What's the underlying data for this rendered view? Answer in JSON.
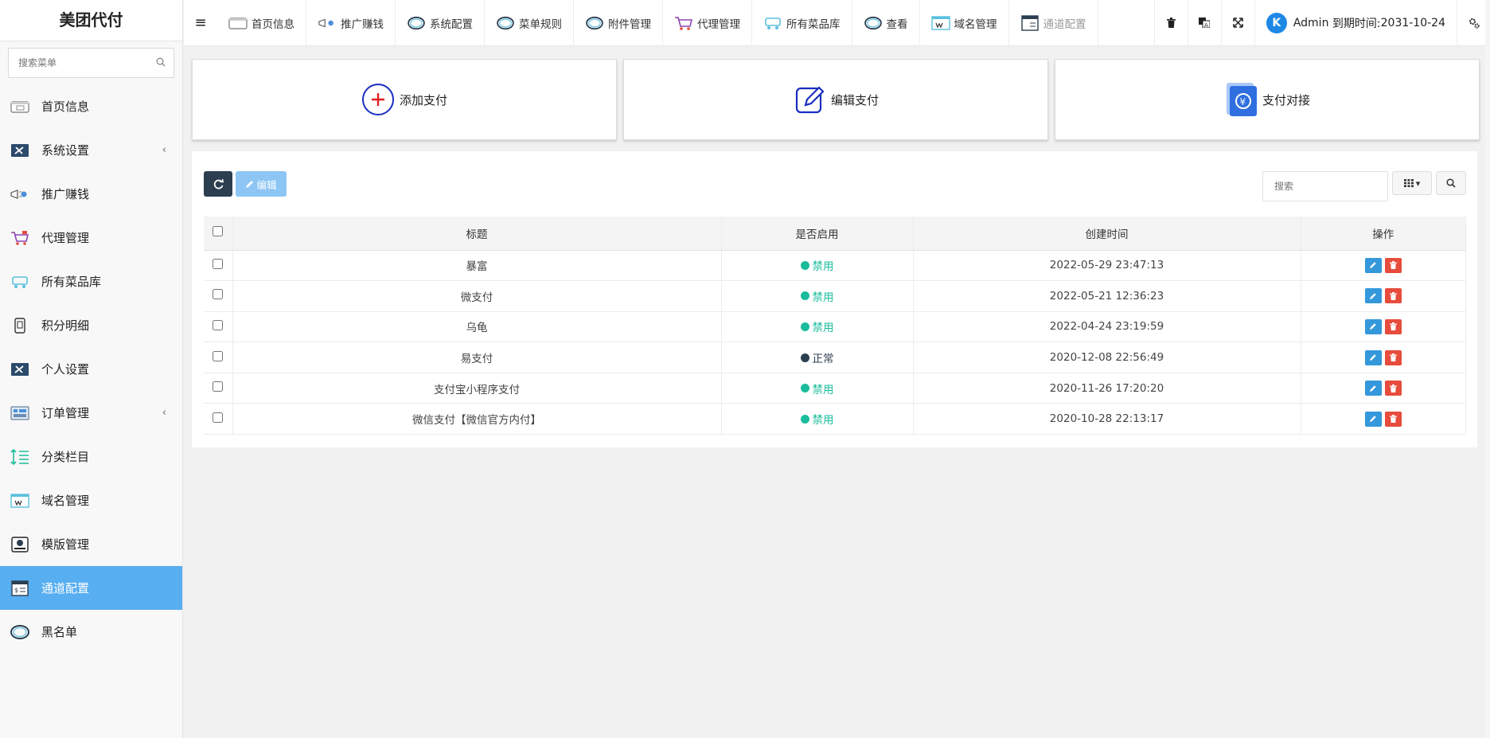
{
  "app": {
    "title": "美团代付"
  },
  "sidebar": {
    "search_placeholder": "搜索菜单",
    "items": [
      {
        "label": "首页信息",
        "icon": "browser-icon",
        "arrow": ""
      },
      {
        "label": "系统设置",
        "icon": "tools-icon",
        "arrow": "‹"
      },
      {
        "label": "推广赚钱",
        "icon": "megaphone-icon",
        "arrow": ""
      },
      {
        "label": "代理管理",
        "icon": "cart-icon",
        "arrow": ""
      },
      {
        "label": "所有菜品库",
        "icon": "trolley-icon",
        "arrow": ""
      },
      {
        "label": "积分明细",
        "icon": "phone-card-icon",
        "arrow": ""
      },
      {
        "label": "个人设置",
        "icon": "tools-icon",
        "arrow": ""
      },
      {
        "label": "订单管理",
        "icon": "orders-icon",
        "arrow": "‹"
      },
      {
        "label": "分类栏目",
        "icon": "sort-list-icon",
        "arrow": ""
      },
      {
        "label": "域名管理",
        "icon": "domain-icon",
        "arrow": ""
      },
      {
        "label": "模版管理",
        "icon": "template-icon",
        "arrow": ""
      },
      {
        "label": "通道配置",
        "icon": "channel-icon",
        "arrow": ""
      },
      {
        "label": "黑名单",
        "icon": "ring-icon",
        "arrow": ""
      }
    ],
    "active_index": 11
  },
  "topnav": {
    "tabs": [
      {
        "label": "首页信息",
        "icon": "browser-icon"
      },
      {
        "label": "推广赚钱",
        "icon": "megaphone-icon"
      },
      {
        "label": "系统配置",
        "icon": "ring-icon"
      },
      {
        "label": "菜单规则",
        "icon": "ring-icon"
      },
      {
        "label": "附件管理",
        "icon": "ring-icon"
      },
      {
        "label": "代理管理",
        "icon": "cart-icon"
      },
      {
        "label": "所有菜品库",
        "icon": "trolley-icon"
      },
      {
        "label": "查看",
        "icon": "ring-icon"
      },
      {
        "label": "域名管理",
        "icon": "domain-icon"
      },
      {
        "label": "通道配置",
        "icon": "channel-icon"
      }
    ],
    "user": {
      "avatar": "K",
      "name": "Admin",
      "expire_label": "到期时间:",
      "expire_date": "2031-10-24"
    }
  },
  "cards": [
    {
      "label": "添加支付",
      "icon": "plus-circle-icon"
    },
    {
      "label": "编辑支付",
      "icon": "edit-square-icon"
    },
    {
      "label": "支付对接",
      "icon": "yuan-wallet-icon"
    }
  ],
  "toolbar": {
    "edit_label": "编辑",
    "search_placeholder": "搜索"
  },
  "table": {
    "headers": [
      "标题",
      "是否启用",
      "创建时间",
      "操作"
    ],
    "rows": [
      {
        "title": "暴富",
        "status": "禁用",
        "status_color": "#1abc9c",
        "created": "2022-05-29 23:47:13"
      },
      {
        "title": "微支付",
        "status": "禁用",
        "status_color": "#1abc9c",
        "created": "2022-05-21 12:36:23"
      },
      {
        "title": "乌龟",
        "status": "禁用",
        "status_color": "#1abc9c",
        "created": "2022-04-24 23:19:59"
      },
      {
        "title": "易支付",
        "status": "正常",
        "status_color": "#2c3e50",
        "created": "2020-12-08 22:56:49"
      },
      {
        "title": "支付宝小程序支付",
        "status": "禁用",
        "status_color": "#1abc9c",
        "created": "2020-11-26 17:20:20"
      },
      {
        "title": "微信支付【微信官方内付】",
        "status": "禁用",
        "status_color": "#1abc9c",
        "created": "2020-10-28 22:13:17"
      }
    ]
  },
  "colors": {
    "accent": "#57aef0",
    "dark_button": "#2c3e50",
    "edit_button": "#3498db",
    "delete_button": "#e74c3c",
    "status_disabled": "#1abc9c"
  }
}
